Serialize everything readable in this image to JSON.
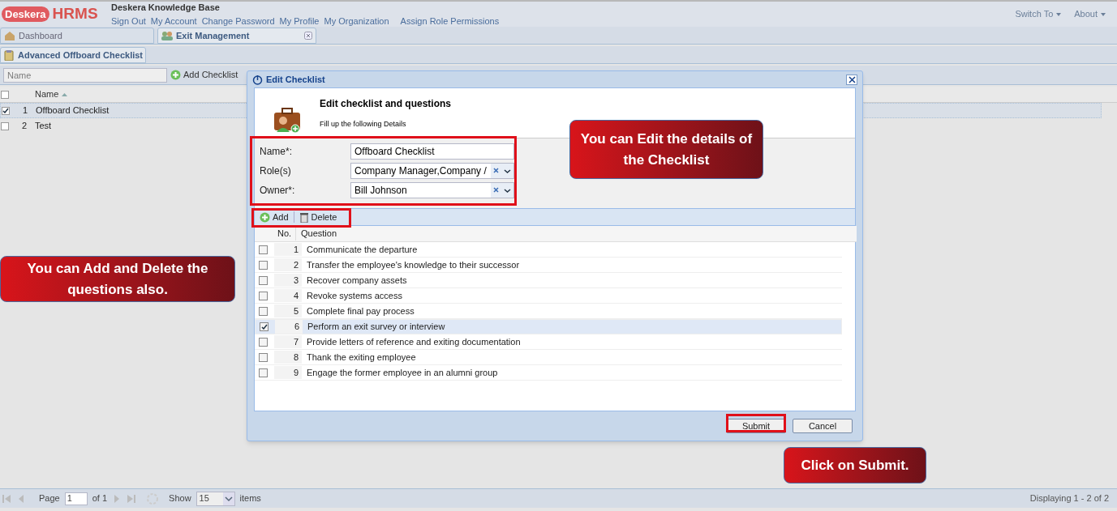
{
  "header": {
    "brand": "Deskera",
    "product": "HRMS",
    "site_title": "Deskera Knowledge Base",
    "links": [
      "Sign Out",
      "My Account",
      "Change Password",
      "My Profile",
      "My Organization",
      "Assign Role Permissions"
    ],
    "menus": [
      "Switch To",
      "About"
    ]
  },
  "tabs": [
    {
      "label": "Dashboard",
      "selected": false,
      "closable": false
    },
    {
      "label": "Exit Management",
      "selected": true,
      "closable": true
    }
  ],
  "subtab": {
    "label": "Advanced Offboard Checklist"
  },
  "toolbar": {
    "search_placeholder": "Name",
    "add_button": "Add Checklist"
  },
  "grid": {
    "column": "Name",
    "all_checked": false,
    "rows": [
      {
        "num": "1",
        "name": "Offboard Checklist",
        "selected": true
      },
      {
        "num": "2",
        "name": "Test",
        "selected": false
      }
    ]
  },
  "dialog": {
    "title": "Edit Checklist",
    "heading": "Edit checklist and questions",
    "subheading": "Fill up the following Details",
    "fields": [
      {
        "label": "Name*:",
        "value": "Offboard Checklist",
        "kind": "text"
      },
      {
        "label": "Role(s)",
        "value": "Company Manager,Company /",
        "kind": "combo"
      },
      {
        "label": "Owner*:",
        "value": "Bill Johnson",
        "kind": "combo"
      }
    ],
    "toolbar": [
      "Add",
      "Delete"
    ],
    "columns": [
      "No.",
      "Question"
    ],
    "questions": [
      {
        "num": "1",
        "text": "Communicate the departure",
        "checked": false
      },
      {
        "num": "2",
        "text": "Transfer the employee's knowledge to their successor",
        "checked": false
      },
      {
        "num": "3",
        "text": "Recover company assets",
        "checked": false
      },
      {
        "num": "4",
        "text": "Revoke systems access",
        "checked": false
      },
      {
        "num": "5",
        "text": "Complete final pay process",
        "checked": false
      },
      {
        "num": "6",
        "text": "Perform an exit survey or interview",
        "checked": true
      },
      {
        "num": "7",
        "text": "Provide letters of reference and exiting documentation",
        "checked": false
      },
      {
        "num": "8",
        "text": "Thank the exiting employee",
        "checked": false
      },
      {
        "num": "9",
        "text": "Engage the former employee in an alumni group",
        "checked": false
      }
    ],
    "buttons": [
      "Submit",
      "Cancel"
    ]
  },
  "callouts": [
    "You can Edit the details of the Checklist",
    "You can Add and Delete the questions also.",
    "Click on Submit."
  ],
  "pager": {
    "page_label": "Page",
    "page": "1",
    "of": "of 1",
    "show": "Show",
    "size": "15",
    "items": "items",
    "display": "Displaying 1 - 2 of 2"
  }
}
